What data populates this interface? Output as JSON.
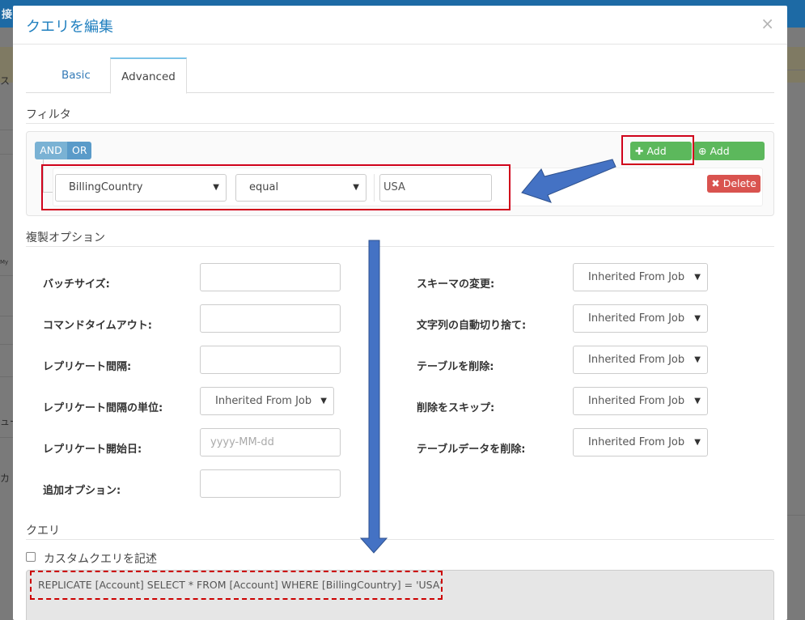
{
  "background": {
    "topbar_text": "接",
    "frag_1": "ス",
    "frag_2": "ュー",
    "frag_3": "カ",
    "frag_4": "My"
  },
  "modal": {
    "title": "クエリを編集",
    "close_glyph": "×",
    "tabs": [
      {
        "label": "Basic",
        "active": false
      },
      {
        "label": "Advanced",
        "active": true
      }
    ]
  },
  "filter": {
    "section_title": "フィルタ",
    "and_label": "AND",
    "or_label": "OR",
    "add_rule_label": "Add rule",
    "add_group_label": "Add group",
    "delete_label": "Delete",
    "rule": {
      "field": "BillingCountry",
      "operator": "equal",
      "value": "USA"
    }
  },
  "replication": {
    "section_title": "複製オプション",
    "left": [
      {
        "label": "バッチサイズ:",
        "type": "input",
        "value": ""
      },
      {
        "label": "コマンドタイムアウト:",
        "type": "input",
        "value": ""
      },
      {
        "label": "レプリケート間隔:",
        "type": "input",
        "value": ""
      },
      {
        "label": "レプリケート間隔の単位:",
        "type": "select",
        "value": "Inherited From Job"
      },
      {
        "label": "レプリケート開始日:",
        "type": "input",
        "value": "",
        "placeholder": "yyyy-MM-dd"
      },
      {
        "label": "追加オプション:",
        "type": "input",
        "value": ""
      }
    ],
    "right": [
      {
        "label": "スキーマの変更:",
        "value": "Inherited From Job"
      },
      {
        "label": "文字列の自動切り捨て:",
        "value": "Inherited From Job"
      },
      {
        "label": "テーブルを削除:",
        "value": "Inherited From Job"
      },
      {
        "label": "削除をスキップ:",
        "value": "Inherited From Job"
      },
      {
        "label": "テーブルデータを削除:",
        "value": "Inherited From Job"
      }
    ]
  },
  "query": {
    "section_title": "クエリ",
    "custom_query_label": "カスタムクエリを記述",
    "custom_query_checked": false,
    "text": "REPLICATE [Account] SELECT * FROM [Account] WHERE [BillingCountry] = 'USA'"
  },
  "colors": {
    "title_blue": "#1f7fbf",
    "green_button": "#5cb85c",
    "red_button": "#d9534f",
    "annotation_red": "#d0021b",
    "annotation_arrow": "#4472c4"
  }
}
